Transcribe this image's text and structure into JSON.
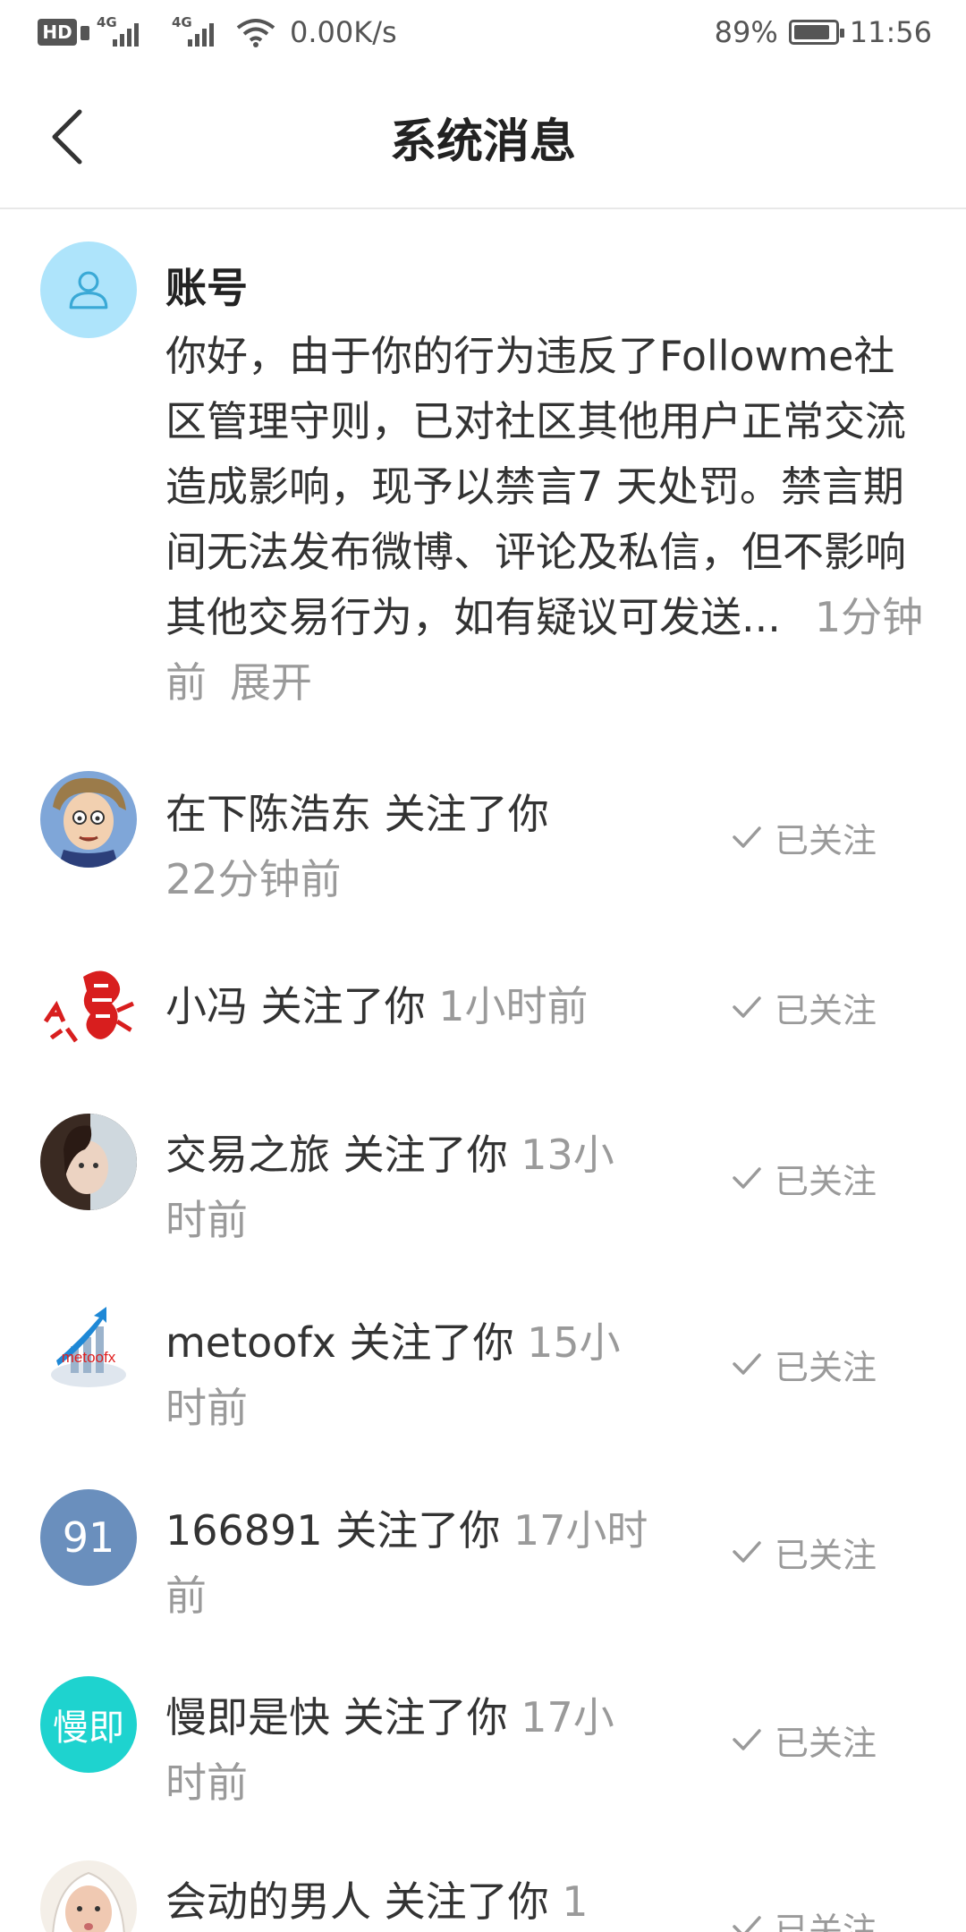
{
  "status_bar": {
    "hd": "HD",
    "signal1": "4G",
    "signal2": "4G",
    "speed": "0.00K/s",
    "battery": "89%",
    "battery_level": 0.89,
    "time": "11:56"
  },
  "header": {
    "title": "系统消息"
  },
  "system_message": {
    "title": "账号",
    "body": "你好，由于你的行为违反了Followme社区管理守则，已对社区其他用户正常交流造成影响，现予以禁言7 天处罚。禁言期间无法发布微博、评论及私信，但不影响其他交易行为，如有疑议可发送...",
    "time": "1分钟前",
    "expand_label": "展开"
  },
  "followers": [
    {
      "name": "在下陈浩东",
      "action": "关注了你",
      "time": "22分钟前",
      "button": "已关注",
      "avatar_icon": "cartoon-avatar"
    },
    {
      "name": "小冯",
      "action": "关注了你",
      "time": "1小时前",
      "button": "已关注",
      "avatar_icon": "red-seal-avatar"
    },
    {
      "name": "交易之旅",
      "action": "关注了你",
      "time": "13小时前",
      "button": "已关注",
      "avatar_icon": "photo-avatar"
    },
    {
      "name": "metoofx",
      "action": "关注了你",
      "time": "15小时前",
      "button": "已关注",
      "avatar_icon": "logo-avatar",
      "avatar_logo_text": "metoofx"
    },
    {
      "name": "166891",
      "action": "关注了你",
      "time": "17小时前",
      "button": "已关注",
      "avatar_text": "91",
      "avatar_color": "#6a8fbd"
    },
    {
      "name": "慢即是快",
      "action": "关注了你",
      "time": "17小时前",
      "button": "已关注",
      "avatar_text": "慢即",
      "avatar_color": "#1ed3cf"
    },
    {
      "name": "会动的男人",
      "action": "关注了你",
      "time": "1",
      "button": "已关注",
      "avatar_icon": "baby-avatar"
    }
  ]
}
